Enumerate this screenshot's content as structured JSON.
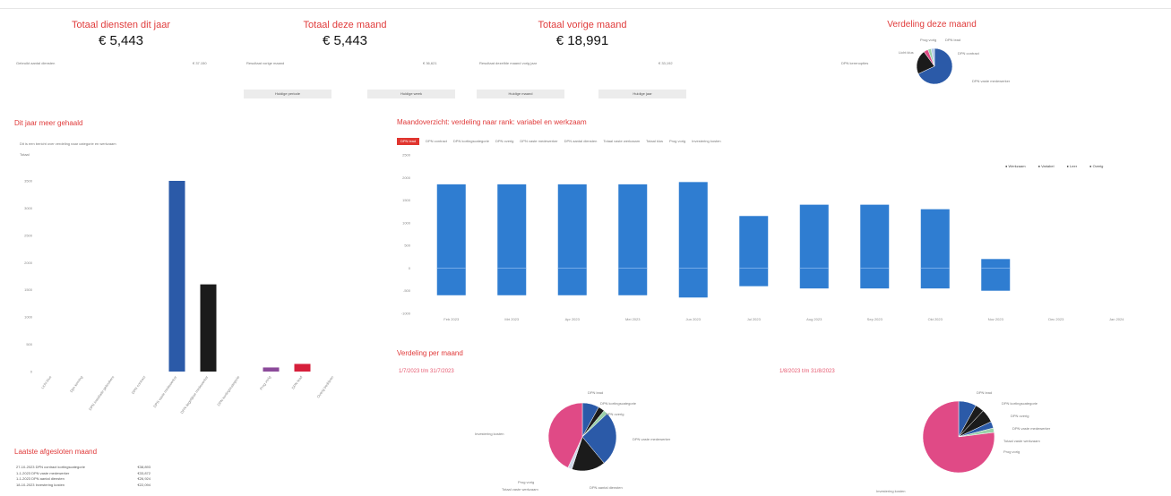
{
  "kpis": [
    {
      "title": "Totaal diensten dit jaar",
      "value": "€ 5,443",
      "sub_label": "Gebruikt aantal diensten",
      "sub_value": "€ 37.150"
    },
    {
      "title": "Totaal deze maand",
      "value": "€ 5,443",
      "sub_label": "Resultaat vorige maand",
      "sub_value": "€ 36,621"
    },
    {
      "title": "Totaal vorige maand",
      "value": "€ 18,991",
      "sub_label": "Resultaat dezelfde maand vorig jaar",
      "sub_value": "€ 33,192"
    }
  ],
  "buttons": [
    "Huidige periode",
    "Huidige week",
    "Huidige maand",
    "Huidige jaar"
  ],
  "top_pie": {
    "title": "Verdeling deze maand",
    "labels": [
      "Prog vorig",
      "DPN lead",
      "Licht klus",
      "DPN kerenopties",
      "DPN contract",
      "DPN vaste medewerker"
    ]
  },
  "left_panel": {
    "title": "Dit jaar meer gehaald",
    "subtitle": "Dit is een bericht over verdeling naar categorie en werkzaam",
    "unit": "Totaal"
  },
  "left_chart": {
    "chart_data": {
      "type": "bar",
      "categories": [
        "Licht klus",
        "Dpn kerning",
        "DPN installatie gebruikers",
        "DPN contract",
        "DPN vaste medewerker",
        "DPN dagelijkse medewerker",
        "DPN kortingscategorie",
        "Prog vorig",
        "DPN lead",
        "Overig bedrijven"
      ],
      "values": [
        0,
        0,
        0,
        0,
        3500,
        1600,
        0,
        75,
        140,
        0
      ],
      "colors": [
        "#2b5aa8",
        "#2b5aa8",
        "#2b5aa8",
        "#2b5aa8",
        "#2b5aa8",
        "#1b1b1b",
        "#2b5aa8",
        "#8b4a9a",
        "#d61f3b",
        "#2b5aa8"
      ],
      "ylim": [
        0,
        3500
      ],
      "yticks": [
        "0",
        "500",
        "1000",
        "1500",
        "2000",
        "2500",
        "3000",
        "3500"
      ]
    }
  },
  "main_panel": {
    "title": "Maandoverzicht: verdeling naar rank: variabel en werkzaam",
    "tabs": [
      "DPN lead",
      "DPN contract",
      "DPN kortingscategorie",
      "DPN overig",
      "DPN vaste medewerker",
      "DPN aantal diensten",
      "Totaal vaste werkzaam",
      "Totaal klus",
      "Prog vorig",
      "Investering kosten"
    ],
    "legend": [
      "Werkzaam",
      "Variabel",
      "Leer",
      "Overig"
    ]
  },
  "main_chart": {
    "chart_data": {
      "type": "bar",
      "categories": [
        "Feb 2023",
        "Mrt 2023",
        "Apr 2023",
        "Mei 2023",
        "Jun 2023",
        "Jul 2023",
        "Aug 2023",
        "Sep 2023",
        "Okt 2023",
        "Nov 2023",
        "Dec 2023",
        "Jan 2024"
      ],
      "series": [
        {
          "name": "Werkzaam",
          "values": [
            1850,
            1850,
            1850,
            1850,
            1900,
            1150,
            1400,
            1400,
            1300,
            200,
            0,
            0
          ]
        },
        {
          "name": "Variabel",
          "values": [
            -600,
            -600,
            -600,
            -600,
            -650,
            -400,
            -450,
            -450,
            -450,
            -500,
            0,
            0
          ]
        }
      ],
      "ylim": [
        -1000,
        2500
      ],
      "yticks": [
        "-1000",
        "-500",
        "0",
        "500",
        "1000",
        "1500",
        "2000",
        "2500"
      ]
    }
  },
  "verdeling": {
    "title": "Verdeling per maand",
    "left_date": "1/7/2023 t/m 31/7/2023",
    "right_date": "1/8/2023 t/m 31/8/2023",
    "left_labels": [
      "DPN lead",
      "DPN kortingscategorie",
      "DPN overig",
      "DPN vaste medewerker",
      "DPN aantal diensten",
      "Totaal vaste werkzaam",
      "Prog vorig",
      "Investering kosten"
    ],
    "right_labels": [
      "DPN lead",
      "DPN kortingscategorie",
      "DPN overig",
      "DPN vaste medewerker",
      "Totaal vaste werkzaam",
      "Prog vorig",
      "Investering kosten"
    ]
  },
  "recent_list": {
    "title": "Laatste afgesloten maand",
    "rows": [
      {
        "text": "27-10-2023 DPN contract kortingscategorie",
        "value": "€38,893"
      },
      {
        "text": "1-1-2023 DPN vaste medewerker",
        "value": "€33,872"
      },
      {
        "text": "1-1-2023 DPN aantal diensten",
        "value": "€26,924"
      },
      {
        "text": "18-10-2023 Investering kosten",
        "value": "€22,094"
      }
    ]
  }
}
